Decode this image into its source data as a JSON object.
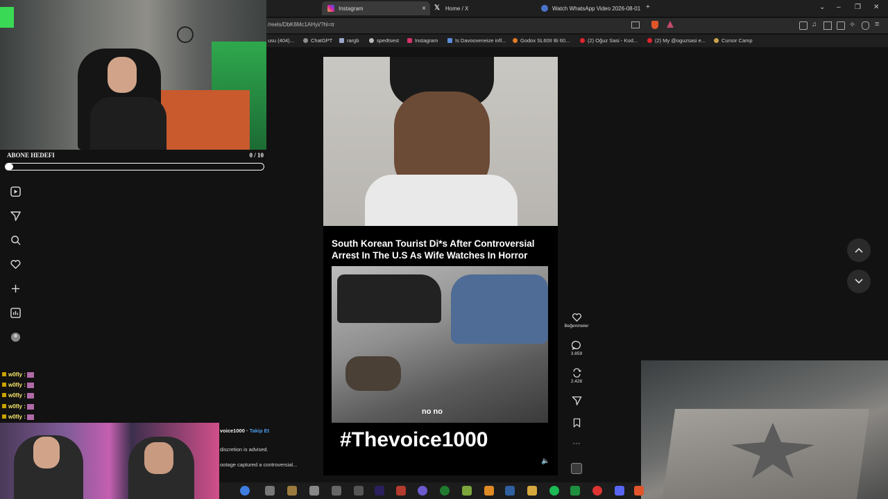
{
  "browser": {
    "tabs": [
      {
        "label": "Instagram",
        "icon": "instagram-icon",
        "active": true
      },
      {
        "label": "Home / X",
        "icon": "x-icon",
        "active": false
      },
      {
        "label": "Watch WhatsApp Video 2026-08-01",
        "icon": "globe-icon",
        "active": false
      }
    ],
    "url": "/reels/DbK6Mc1AHyi/?hl=tr",
    "bookmarks": [
      {
        "label": "usu (404)...",
        "color": "#3b3b3b"
      },
      {
        "label": "ChatGPT",
        "color": "#8d8d8d"
      },
      {
        "label": "rargb",
        "color": "#9aa6c8"
      },
      {
        "label": "spedtsest",
        "color": "#bbbbbb"
      },
      {
        "label": "Instagram",
        "color": "#d6336c"
      },
      {
        "label": "Is Davooxeneize infl...",
        "color": "#5b8bd9"
      },
      {
        "label": "Godox SL60II Bi 60...",
        "color": "#e07b26"
      },
      {
        "label": "(2) Oğuz Sasi - Kod...",
        "color": "#e0242d"
      },
      {
        "label": "(2) My @oguzsasi e...",
        "color": "#e0242d"
      },
      {
        "label": "Cursor Camp",
        "color": "#c9a44a"
      }
    ]
  },
  "overlay": {
    "sub_goal_label": "ABONE HEDEFI",
    "sub_goal_count": "0 / 10",
    "sub_goal_progress": 0.03
  },
  "chat": [
    {
      "user": "w0fly :"
    },
    {
      "user": "w0fly :"
    },
    {
      "user": "w0fly :"
    },
    {
      "user": "w0fly :"
    },
    {
      "user": "w0fly :"
    }
  ],
  "reel": {
    "headline": "South Korean Tourist Di*s After Controversial Arrest In The U.S As Wife Watches In Horror",
    "subtitle": "no no",
    "hashtag": "#Thevoice1000",
    "username": "voice1000",
    "follow_label": "Takip Et",
    "caption_line1": "discretion is advised.",
    "caption_line2": "ootage captured a controversial...",
    "actions": {
      "like_label": "Beğenmeler",
      "comments": "3.859",
      "reposts": "2.428"
    }
  },
  "colors": {
    "accent_link": "#4c9be8",
    "chat_name": "#f5e26b",
    "webcam_led": "#39ff5a"
  }
}
